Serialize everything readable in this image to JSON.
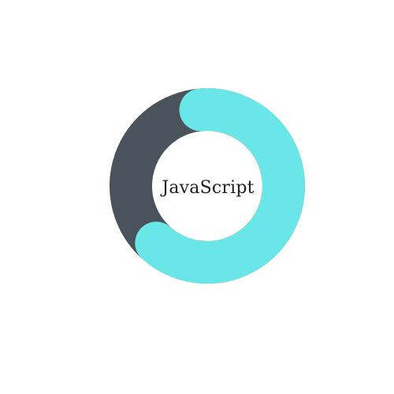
{
  "chart_data": {
    "type": "pie",
    "variant": "donut-progress",
    "center_label": "JavaScript",
    "value_percent": 63,
    "colors": {
      "progress": "#6ae5e8",
      "track": "#4a525c",
      "background": "#ffffff"
    }
  }
}
